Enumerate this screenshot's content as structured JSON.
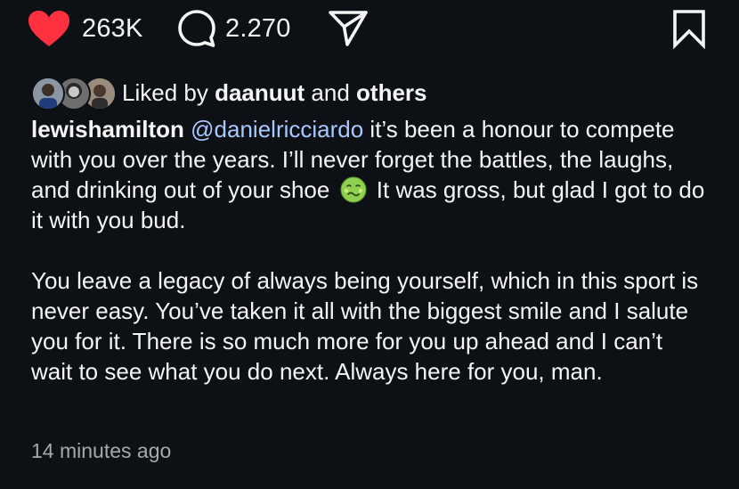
{
  "actions": {
    "likes_count": "263K",
    "comments_count": "2.270"
  },
  "liked_by": {
    "prefix": "Liked by",
    "user": "daanuut",
    "connector": "and",
    "others": "others"
  },
  "caption": {
    "username": "lewishamilton",
    "mention": "@danielricciardo",
    "paragraph1_part1": " it’s been a honour to compete with you over the years. I’ll never forget the battles, the laughs, and drinking out of your shoe",
    "emoji": "nauseated-face",
    "paragraph1_part2": " It was gross, but glad I got to do it with you bud.",
    "paragraph2": "You leave a legacy of always being yourself, which in this sport is never easy. You’ve taken it all with the biggest smile and I salute you for it. There is so much more for you up ahead and I can’t wait to see what you do next. Always here for you, man."
  },
  "timestamp": "14 minutes ago",
  "colors": {
    "background": "#0d1014",
    "like": "#ff3040",
    "mention": "#a8c9ff",
    "muted_text": "#a8a8a8"
  },
  "icons": [
    "heart-icon",
    "comment-icon",
    "share-icon",
    "bookmark-icon",
    "nauseated-face-emoji"
  ]
}
